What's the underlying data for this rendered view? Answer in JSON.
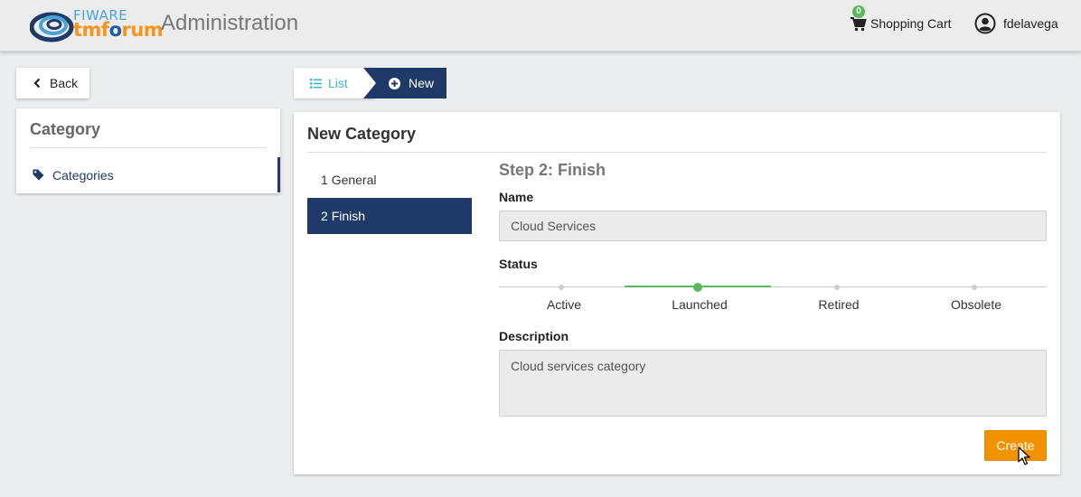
{
  "header": {
    "logo_top": "FIWARE",
    "logo_bottom_a": "tmf",
    "logo_bottom_b": "o",
    "logo_bottom_c": "rum",
    "title": "Administration",
    "cart_count": "0",
    "cart_label": "Shopping Cart",
    "user_name": "fdelavega"
  },
  "sidebar": {
    "back_label": "Back",
    "panel_title": "Category",
    "items": [
      {
        "label": "Categories",
        "icon": "tag-icon"
      }
    ]
  },
  "breadcrumb": {
    "list_label": "List",
    "new_label": "New"
  },
  "main": {
    "title": "New Category",
    "steps": [
      {
        "number": "1",
        "label": "General"
      },
      {
        "number": "2",
        "label": "Finish"
      }
    ],
    "step_heading": "Step 2: Finish",
    "name_label": "Name",
    "name_value": "Cloud Services",
    "status_label": "Status",
    "statuses": [
      "Active",
      "Launched",
      "Retired",
      "Obsolete"
    ],
    "status_selected": "Launched",
    "description_label": "Description",
    "description_value": "Cloud services category",
    "create_label": "Create"
  },
  "colors": {
    "navy": "#1f3a68",
    "accent_orange": "#f39200",
    "status_green": "#5cb85c",
    "link_teal": "#3eb5cc"
  }
}
